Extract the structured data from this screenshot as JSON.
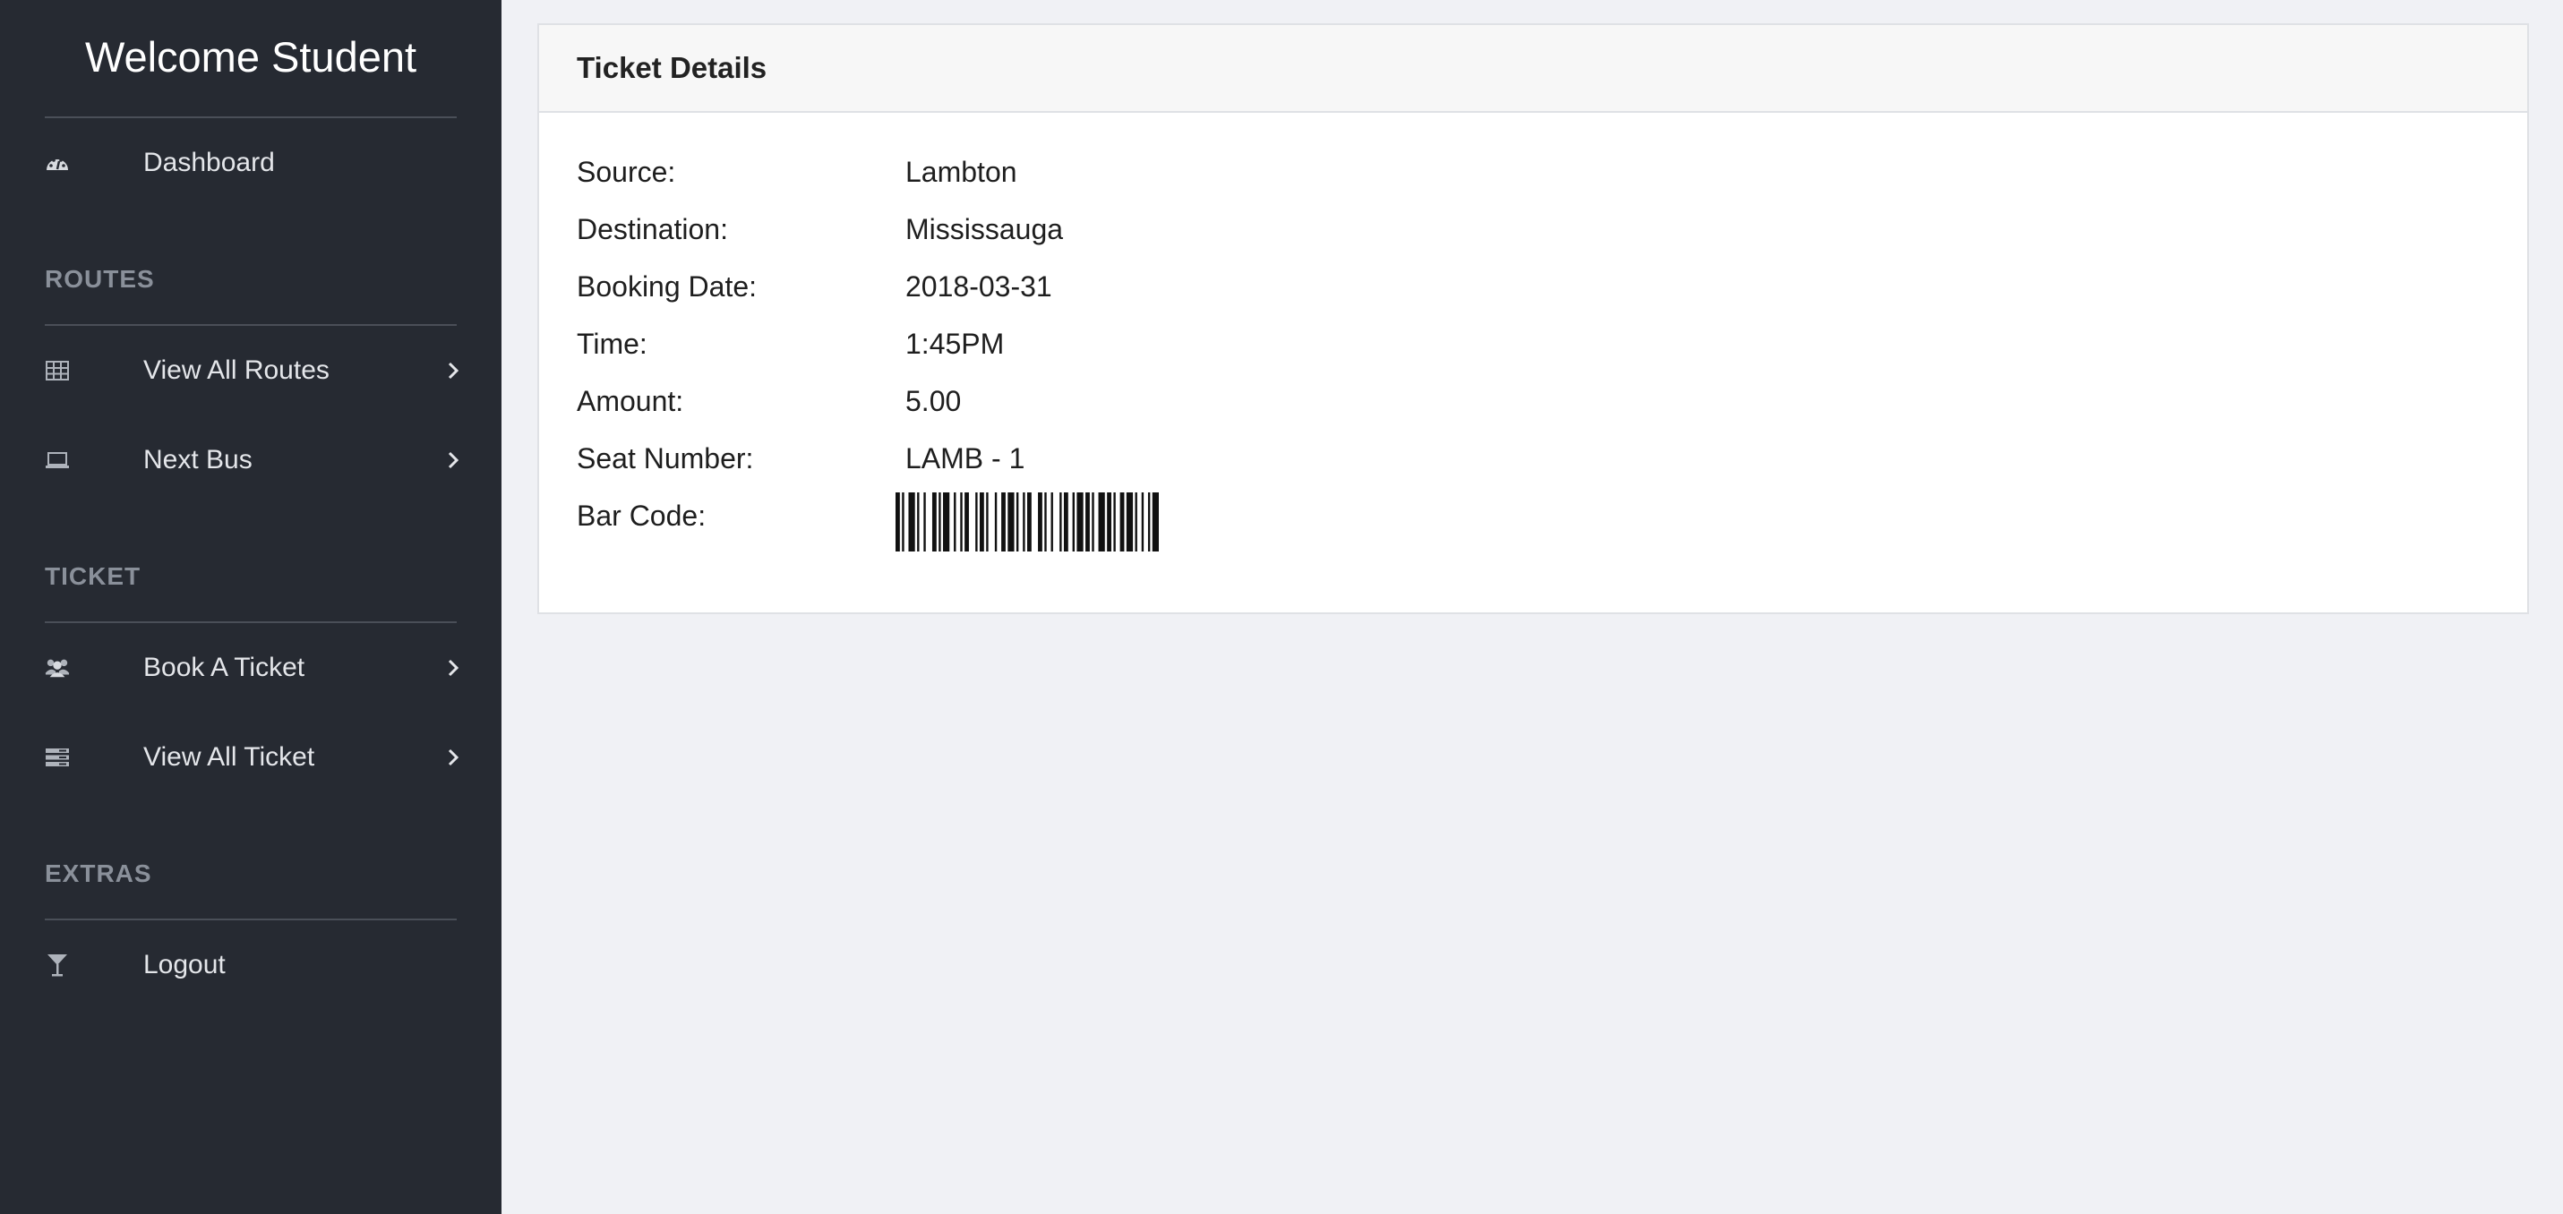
{
  "sidebar": {
    "title": "Welcome Student",
    "dashboard": {
      "label": "Dashboard",
      "icon": "dashboard-icon"
    },
    "sections": {
      "routes": "ROUTES",
      "ticket": "TICKET",
      "extras": "EXTRAS"
    },
    "items": {
      "view_all_routes": {
        "label": "View All Routes",
        "icon": "table-icon"
      },
      "next_bus": {
        "label": "Next Bus",
        "icon": "laptop-icon"
      },
      "book_a_ticket": {
        "label": "Book A Ticket",
        "icon": "users-icon"
      },
      "view_all_ticket": {
        "label": "View All Ticket",
        "icon": "list-icon"
      },
      "logout": {
        "label": "Logout",
        "icon": "cocktail-glass-icon"
      }
    }
  },
  "ticket": {
    "title": "Ticket Details",
    "fields": [
      {
        "label": "Source:",
        "value": "Lambton"
      },
      {
        "label": "Destination:",
        "value": "Mississauga"
      },
      {
        "label": "Booking Date:",
        "value": "2018-03-31"
      },
      {
        "label": "Time:",
        "value": "1:45PM"
      },
      {
        "label": "Amount:",
        "value": "5.00"
      },
      {
        "label": "Seat Number:",
        "value": "LAMB - 1"
      }
    ],
    "barcode_label": "Bar Code:"
  },
  "colors": {
    "sidebar_bg": "#262a32",
    "page_bg": "#f0f1f5",
    "card_header_bg": "#f7f7f7",
    "section_label": "#8a909a"
  }
}
